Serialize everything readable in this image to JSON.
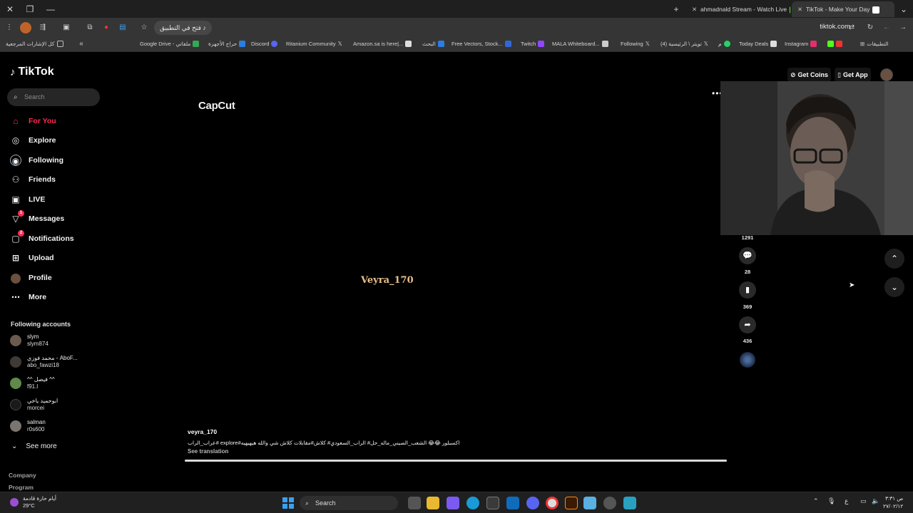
{
  "browser": {
    "tabs": [
      {
        "title": "ahmadnald Stream - Watch Live",
        "favicon_color": "#53fc18"
      },
      {
        "title": "TikTok - Make Your Day",
        "favicon_color": "#ffffff"
      }
    ],
    "open_in_app_label": "فتح في التطبيق",
    "url": "tiktok.com",
    "bookmarks": [
      {
        "label": "كل الإشارات المرجعية",
        "color": "#bbbbbb"
      },
      {
        "label": "Google Drive - ملفاتي",
        "color": "#34a853"
      },
      {
        "label": "حراج الأجهزة",
        "color": "#2a7de1"
      },
      {
        "label": "Discord",
        "color": "#5865f2"
      },
      {
        "label": "Ritanium Community",
        "color": "#dddddd"
      },
      {
        "label": "Amazon.sa is here|...",
        "color": "#dddddd"
      },
      {
        "label": "البحث",
        "color": "#2a7de1"
      },
      {
        "label": "Free Vectors, Stock...",
        "color": "#3367d6"
      },
      {
        "label": "Twitch",
        "color": "#9146ff"
      },
      {
        "label": "MALA Whiteboard...",
        "color": "#cccccc"
      },
      {
        "label": "Following",
        "color": "#dddddd"
      },
      {
        "label": "(4) تويتر \\ الرئيسية",
        "color": "#dddddd"
      },
      {
        "label": "م",
        "color": "#25d366"
      },
      {
        "label": "Today Deals",
        "color": "#dddddd"
      },
      {
        "label": "Instagram",
        "color": "#e1306c"
      },
      {
        "label": "التطبيقات",
        "color": "#aaaaaa"
      }
    ]
  },
  "sidebar": {
    "logo": "TikTok",
    "search_placeholder": "Search",
    "nav": [
      {
        "label": "For You",
        "icon": "home-icon",
        "glyph": "⌂",
        "badge": ""
      },
      {
        "label": "Explore",
        "icon": "compass-icon",
        "glyph": "◎",
        "badge": ""
      },
      {
        "label": "Following",
        "icon": "following-icon",
        "glyph": "◉",
        "badge": ""
      },
      {
        "label": "Friends",
        "icon": "friends-icon",
        "glyph": "👥",
        "badge": ""
      },
      {
        "label": "LIVE",
        "icon": "live-icon",
        "glyph": "▣",
        "badge": ""
      },
      {
        "label": "Messages",
        "icon": "messages-icon",
        "glyph": "▽",
        "badge": "1"
      },
      {
        "label": "Notifications",
        "icon": "notifications-icon",
        "glyph": "▢",
        "badge": "2"
      },
      {
        "label": "Upload",
        "icon": "upload-icon",
        "glyph": "⊞",
        "badge": ""
      },
      {
        "label": "Profile",
        "icon": "profile-icon",
        "glyph": "●",
        "badge": ""
      },
      {
        "label": "More",
        "icon": "more-icon",
        "glyph": "⋯",
        "badge": ""
      }
    ],
    "following_title": "Following accounts",
    "accounts": [
      {
        "name": "slym",
        "handle": "slym874"
      },
      {
        "name": "محمد فوزي - AboF...",
        "handle": "abo_fawzi18"
      },
      {
        "name": "^^ فيصل ^^",
        "handle": "f91.l"
      },
      {
        "name": "ابوحميد ياخي",
        "handle": "morcei"
      },
      {
        "name": "salman",
        "handle": "r0s600"
      }
    ],
    "see_more": "See more",
    "footer": [
      "Company",
      "Program"
    ]
  },
  "video": {
    "capcut_logo": "CapCut",
    "watermark": "Veyra_170",
    "author": "veyra_170",
    "caption": "عراب_الراب# explore#اكسبلور 😂😂 الشعب_الصيني_ماله_حل# الراب_السعودي# كلاش#مقابلات كلاش شي والله هيهيهيه",
    "see_translation": "See translation",
    "progress": 1.0
  },
  "actions": {
    "like_count": "1291",
    "comment_count": "28",
    "save_count": "369",
    "share_count": "436"
  },
  "header": {
    "get_coins": "Get Coins",
    "get_app": "Get App"
  },
  "taskbar": {
    "weather_text": "أيام حارة قادمة",
    "temperature": "29°C",
    "search_label": "Search",
    "time": "۳:۳۱ ص",
    "date": "۲۷/۰۲/۱۲"
  }
}
